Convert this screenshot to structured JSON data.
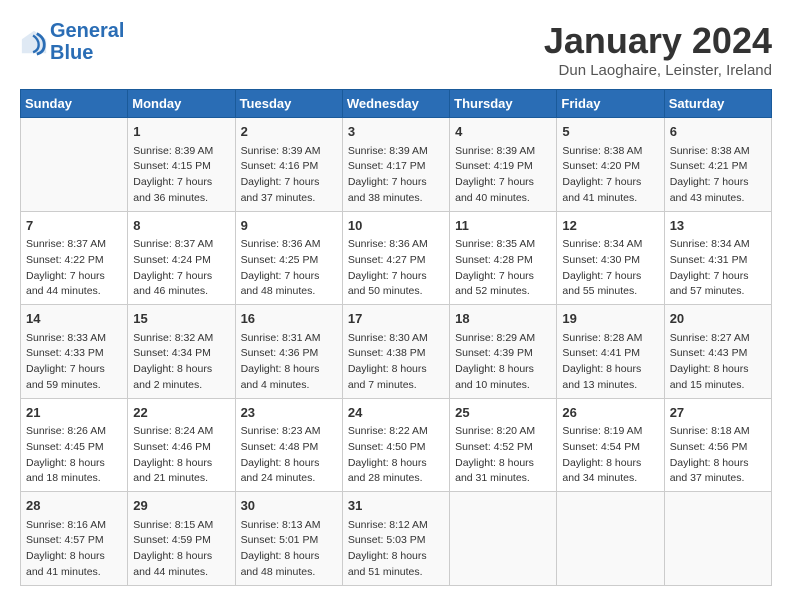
{
  "header": {
    "logo_line1": "General",
    "logo_line2": "Blue",
    "month_title": "January 2024",
    "location": "Dun Laoghaire, Leinster, Ireland"
  },
  "days_of_week": [
    "Sunday",
    "Monday",
    "Tuesday",
    "Wednesday",
    "Thursday",
    "Friday",
    "Saturday"
  ],
  "weeks": [
    [
      {
        "day": "",
        "sunrise": "",
        "sunset": "",
        "daylight": ""
      },
      {
        "day": "1",
        "sunrise": "Sunrise: 8:39 AM",
        "sunset": "Sunset: 4:15 PM",
        "daylight": "Daylight: 7 hours and 36 minutes."
      },
      {
        "day": "2",
        "sunrise": "Sunrise: 8:39 AM",
        "sunset": "Sunset: 4:16 PM",
        "daylight": "Daylight: 7 hours and 37 minutes."
      },
      {
        "day": "3",
        "sunrise": "Sunrise: 8:39 AM",
        "sunset": "Sunset: 4:17 PM",
        "daylight": "Daylight: 7 hours and 38 minutes."
      },
      {
        "day": "4",
        "sunrise": "Sunrise: 8:39 AM",
        "sunset": "Sunset: 4:19 PM",
        "daylight": "Daylight: 7 hours and 40 minutes."
      },
      {
        "day": "5",
        "sunrise": "Sunrise: 8:38 AM",
        "sunset": "Sunset: 4:20 PM",
        "daylight": "Daylight: 7 hours and 41 minutes."
      },
      {
        "day": "6",
        "sunrise": "Sunrise: 8:38 AM",
        "sunset": "Sunset: 4:21 PM",
        "daylight": "Daylight: 7 hours and 43 minutes."
      }
    ],
    [
      {
        "day": "7",
        "sunrise": "Sunrise: 8:37 AM",
        "sunset": "Sunset: 4:22 PM",
        "daylight": "Daylight: 7 hours and 44 minutes."
      },
      {
        "day": "8",
        "sunrise": "Sunrise: 8:37 AM",
        "sunset": "Sunset: 4:24 PM",
        "daylight": "Daylight: 7 hours and 46 minutes."
      },
      {
        "day": "9",
        "sunrise": "Sunrise: 8:36 AM",
        "sunset": "Sunset: 4:25 PM",
        "daylight": "Daylight: 7 hours and 48 minutes."
      },
      {
        "day": "10",
        "sunrise": "Sunrise: 8:36 AM",
        "sunset": "Sunset: 4:27 PM",
        "daylight": "Daylight: 7 hours and 50 minutes."
      },
      {
        "day": "11",
        "sunrise": "Sunrise: 8:35 AM",
        "sunset": "Sunset: 4:28 PM",
        "daylight": "Daylight: 7 hours and 52 minutes."
      },
      {
        "day": "12",
        "sunrise": "Sunrise: 8:34 AM",
        "sunset": "Sunset: 4:30 PM",
        "daylight": "Daylight: 7 hours and 55 minutes."
      },
      {
        "day": "13",
        "sunrise": "Sunrise: 8:34 AM",
        "sunset": "Sunset: 4:31 PM",
        "daylight": "Daylight: 7 hours and 57 minutes."
      }
    ],
    [
      {
        "day": "14",
        "sunrise": "Sunrise: 8:33 AM",
        "sunset": "Sunset: 4:33 PM",
        "daylight": "Daylight: 7 hours and 59 minutes."
      },
      {
        "day": "15",
        "sunrise": "Sunrise: 8:32 AM",
        "sunset": "Sunset: 4:34 PM",
        "daylight": "Daylight: 8 hours and 2 minutes."
      },
      {
        "day": "16",
        "sunrise": "Sunrise: 8:31 AM",
        "sunset": "Sunset: 4:36 PM",
        "daylight": "Daylight: 8 hours and 4 minutes."
      },
      {
        "day": "17",
        "sunrise": "Sunrise: 8:30 AM",
        "sunset": "Sunset: 4:38 PM",
        "daylight": "Daylight: 8 hours and 7 minutes."
      },
      {
        "day": "18",
        "sunrise": "Sunrise: 8:29 AM",
        "sunset": "Sunset: 4:39 PM",
        "daylight": "Daylight: 8 hours and 10 minutes."
      },
      {
        "day": "19",
        "sunrise": "Sunrise: 8:28 AM",
        "sunset": "Sunset: 4:41 PM",
        "daylight": "Daylight: 8 hours and 13 minutes."
      },
      {
        "day": "20",
        "sunrise": "Sunrise: 8:27 AM",
        "sunset": "Sunset: 4:43 PM",
        "daylight": "Daylight: 8 hours and 15 minutes."
      }
    ],
    [
      {
        "day": "21",
        "sunrise": "Sunrise: 8:26 AM",
        "sunset": "Sunset: 4:45 PM",
        "daylight": "Daylight: 8 hours and 18 minutes."
      },
      {
        "day": "22",
        "sunrise": "Sunrise: 8:24 AM",
        "sunset": "Sunset: 4:46 PM",
        "daylight": "Daylight: 8 hours and 21 minutes."
      },
      {
        "day": "23",
        "sunrise": "Sunrise: 8:23 AM",
        "sunset": "Sunset: 4:48 PM",
        "daylight": "Daylight: 8 hours and 24 minutes."
      },
      {
        "day": "24",
        "sunrise": "Sunrise: 8:22 AM",
        "sunset": "Sunset: 4:50 PM",
        "daylight": "Daylight: 8 hours and 28 minutes."
      },
      {
        "day": "25",
        "sunrise": "Sunrise: 8:20 AM",
        "sunset": "Sunset: 4:52 PM",
        "daylight": "Daylight: 8 hours and 31 minutes."
      },
      {
        "day": "26",
        "sunrise": "Sunrise: 8:19 AM",
        "sunset": "Sunset: 4:54 PM",
        "daylight": "Daylight: 8 hours and 34 minutes."
      },
      {
        "day": "27",
        "sunrise": "Sunrise: 8:18 AM",
        "sunset": "Sunset: 4:56 PM",
        "daylight": "Daylight: 8 hours and 37 minutes."
      }
    ],
    [
      {
        "day": "28",
        "sunrise": "Sunrise: 8:16 AM",
        "sunset": "Sunset: 4:57 PM",
        "daylight": "Daylight: 8 hours and 41 minutes."
      },
      {
        "day": "29",
        "sunrise": "Sunrise: 8:15 AM",
        "sunset": "Sunset: 4:59 PM",
        "daylight": "Daylight: 8 hours and 44 minutes."
      },
      {
        "day": "30",
        "sunrise": "Sunrise: 8:13 AM",
        "sunset": "Sunset: 5:01 PM",
        "daylight": "Daylight: 8 hours and 48 minutes."
      },
      {
        "day": "31",
        "sunrise": "Sunrise: 8:12 AM",
        "sunset": "Sunset: 5:03 PM",
        "daylight": "Daylight: 8 hours and 51 minutes."
      },
      {
        "day": "",
        "sunrise": "",
        "sunset": "",
        "daylight": ""
      },
      {
        "day": "",
        "sunrise": "",
        "sunset": "",
        "daylight": ""
      },
      {
        "day": "",
        "sunrise": "",
        "sunset": "",
        "daylight": ""
      }
    ]
  ]
}
